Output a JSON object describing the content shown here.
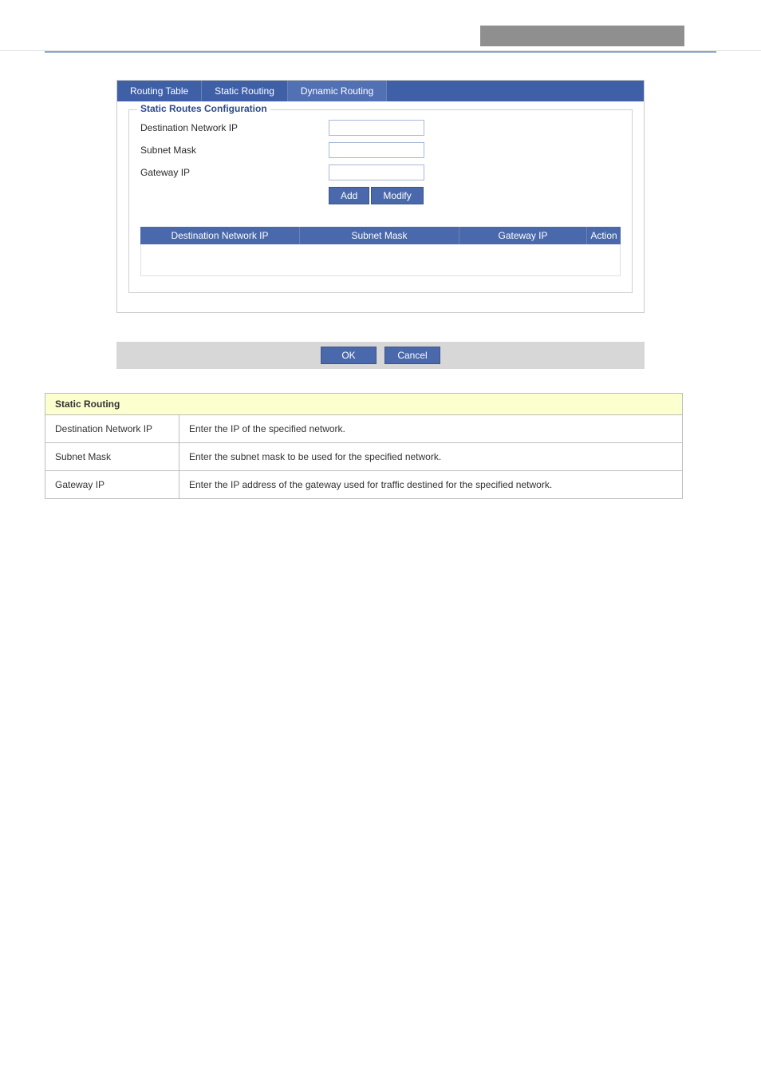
{
  "tabs": {
    "routing_table": "Routing Table",
    "static_routing": "Static Routing",
    "dynamic_routing": "Dynamic Routing"
  },
  "fieldset": {
    "legend": "Static Routes Configuration",
    "dest_ip_label": "Destination Network IP",
    "subnet_label": "Subnet Mask",
    "gateway_label": "Gateway IP",
    "dest_ip_value": "",
    "subnet_value": "",
    "gateway_value": "",
    "add_label": "Add",
    "modify_label": "Modify"
  },
  "routes_table": {
    "col_dest": "Destination Network IP",
    "col_subnet": "Subnet Mask",
    "col_gateway": "Gateway IP",
    "col_action": "Action"
  },
  "footer": {
    "ok": "OK",
    "cancel": "Cancel"
  },
  "param_table": {
    "header": "Static Routing",
    "rows": [
      {
        "label": "Destination Network IP",
        "desc": "Enter the IP of the specified network."
      },
      {
        "label": "Subnet Mask",
        "desc": "Enter the subnet mask to be used for the specified network."
      },
      {
        "label": "Gateway IP",
        "desc": "Enter the IP address of the gateway used for traffic destined for the specified network."
      }
    ]
  }
}
